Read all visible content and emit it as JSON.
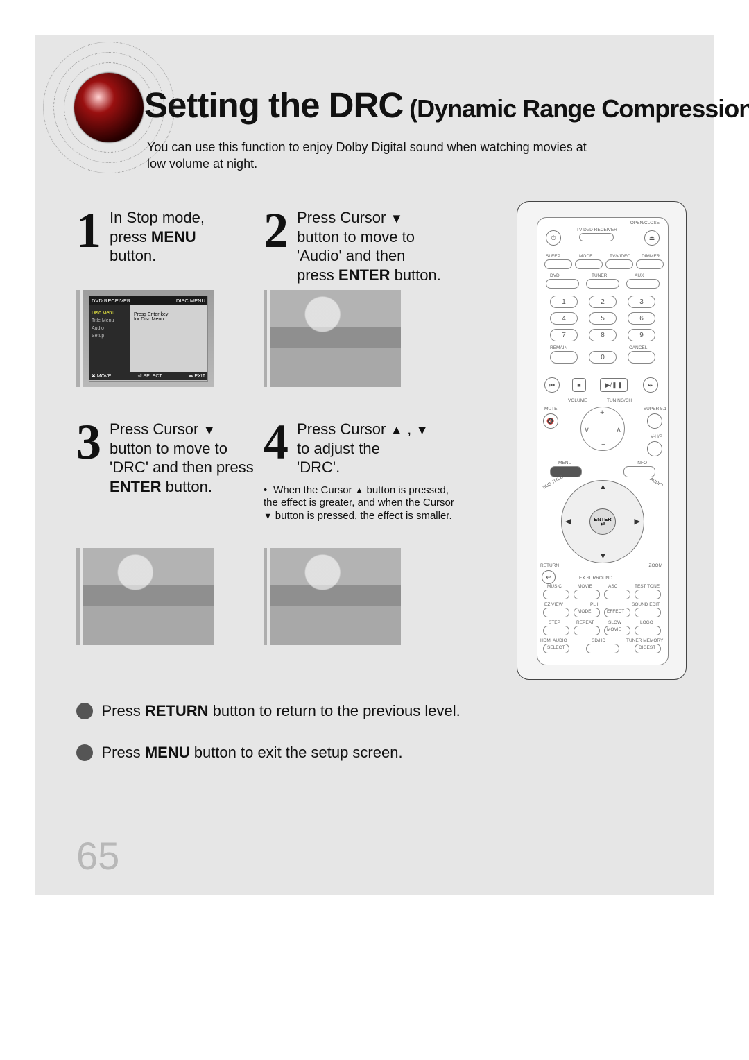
{
  "title": {
    "big": "Setting the DRC",
    "small": " (Dynamic Range Compression)"
  },
  "intro": "You can use this function to enjoy Dolby Digital sound when watching movies at low volume at night.",
  "step1": {
    "num": "1",
    "line1_a": "In Stop mode,",
    "line2_a": "press ",
    "line2_b": "MENU",
    "line3_a": "button."
  },
  "step2": {
    "num": "2",
    "line1_a": "Press Cursor ",
    "line1_tri": "▼",
    "line2_a": "button to move to",
    "line3_a": "'Audio' and then",
    "line4_a": "press ",
    "line4_b": "ENTER",
    "line4_c": " button."
  },
  "step3": {
    "num": "3",
    "line1_a": "Press Cursor ",
    "line1_tri": "▼",
    "line2_a": "button to move to",
    "line3_a": "'DRC' and then press",
    "line4_b": "ENTER",
    "line4_c": " button."
  },
  "step4": {
    "num": "4",
    "line1_a": "Press Cursor ",
    "line1_tri1": "▲",
    "line1_sep": " , ",
    "line1_tri2": "▼",
    "line2_a": "to adjust the",
    "line3_a": "'DRC'.",
    "note_a": "When the Cursor ",
    "note_tri1": "▲",
    "note_b": " button is pressed, the effect is greater, and when the Cursor ",
    "note_tri2": "▼",
    "note_c": " button is pressed, the effect is smaller."
  },
  "osd": {
    "top_left": "DVD RECEIVER",
    "top_right": "DISC MENU",
    "side_items": [
      "Disc Menu",
      "Title Menu",
      "Audio",
      "Setup"
    ],
    "main_line1": "Press Enter key",
    "main_line2": "for Disc Menu",
    "bot_left": "✖ MOVE",
    "bot_mid": "⏎ SELECT",
    "bot_right": "⏏ EXIT"
  },
  "remote": {
    "top": {
      "open_close": "OPEN/CLOSE",
      "power": "⏻",
      "tv_receiver": "TV   DVD RECEIVER",
      "eject": "⏏"
    },
    "row_source_labels": {
      "sleep": "SLEEP",
      "mode": "MODE",
      "tvvideo": "TV/VIDEO",
      "dimmer": "DIMMER"
    },
    "row_source2_labels": {
      "dvd": "DVD",
      "tuner": "TUNER",
      "aux": "AUX"
    },
    "numpad": [
      "1",
      "2",
      "3",
      "4",
      "5",
      "6",
      "7",
      "8",
      "9",
      "0"
    ],
    "remain": "REMAIN",
    "cancel": "CANCEL",
    "transport": {
      "prev": "⏮",
      "stop": "■",
      "play": "▶/❚❚",
      "next": "⏭"
    },
    "volume_label": "VOLUME",
    "tuning_label": "TUNING/CH",
    "mute": "MUTE",
    "mute_icon": "🔇",
    "super51": "SUPER 5.1",
    "vhp": "V-H/P",
    "menu": "MENU",
    "info": "INFO",
    "subtitle": "SUB TITLE",
    "audio": "AUDIO",
    "enter": "ENTER",
    "enter_sub": "⏎",
    "return": "RETURN",
    "return_icon": "↩",
    "zoom": "ZOOM",
    "exsurround": "EX SURROUND",
    "rows": {
      "r1": [
        "MUSIC",
        "MOVIE",
        "ASC",
        "TEST TONE"
      ],
      "r2": [
        "EZ VIEW",
        "PL II",
        "SOUND EDIT"
      ],
      "r2_mid": [
        "MODE",
        "EFFECT"
      ],
      "r3": [
        "STEP",
        "REPEAT",
        "SLOW",
        "LOGO"
      ],
      "r3_mid": "MOVIE",
      "r4": [
        "HDMI AUDIO",
        "SD/HD",
        "TUNER MEMORY"
      ],
      "r4_btn": [
        "SELECT",
        "",
        "DIGEST"
      ]
    }
  },
  "foot1_a": "Press ",
  "foot1_b": "RETURN",
  "foot1_c": " button to return to the previous level.",
  "foot2_a": "Press ",
  "foot2_b": "MENU",
  "foot2_c": " button to exit the setup screen.",
  "page_number": "65"
}
